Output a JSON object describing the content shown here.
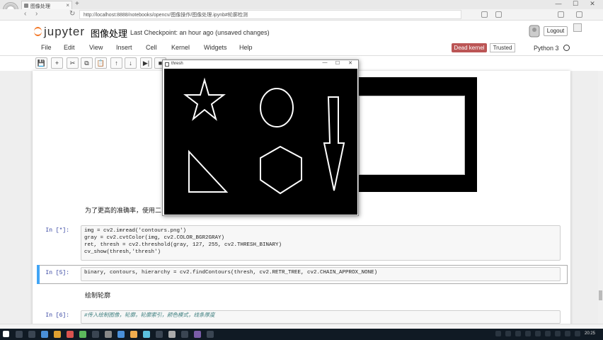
{
  "browser": {
    "tab_title": "图像处理",
    "url": "http://localhost:8888/notebooks/opencv/图像操作/图像处理.ipynb#轮廓检测",
    "new_tab": "+",
    "back": "‹",
    "forward": "›",
    "reload": "↻",
    "window_min": "—",
    "window_max": "☐",
    "window_close": "✕"
  },
  "jupyter": {
    "logo_text": "jupyter",
    "notebook_name": "图像处理",
    "checkpoint": "Last Checkpoint: an hour ago  (unsaved changes)",
    "logout": "Logout",
    "menu": [
      "File",
      "Edit",
      "View",
      "Insert",
      "Cell",
      "Kernel",
      "Widgets",
      "Help"
    ],
    "dead_kernel": "Dead kernel",
    "trusted": "Trusted",
    "kernel_name": "Python 3"
  },
  "toolbar": {
    "buttons": [
      "💾",
      "+",
      "✂",
      "⧉",
      "📋",
      "↑",
      "↓",
      "▶|",
      "■"
    ]
  },
  "notebook": {
    "md1": "为了更高的准确率，使用二",
    "cell1_prompt": "In [*]:",
    "cell1_lines": [
      "img = cv2.imread('contours.png')",
      "gray = cv2.cvtColor(img, cv2.COLOR_BGR2GRAY)",
      "ret, thresh = cv2.threshold(gray, 127, 255, cv2.THRESH_BINARY)",
      "cv_show(thresh,'thresh')"
    ],
    "cell2_prompt": "In [5]:",
    "cell2_line": "binary, contours, hierarchy = cv2.findContours(thresh, cv2.RETR_TREE, cv2.CHAIN_APPROX_NONE)",
    "md2": "绘制轮廓",
    "cell3_prompt": "In [6]:",
    "cell3_line": "#传入绘制图像，轮廓，轮廓索引，颜色模式，线条厚度"
  },
  "thresh_window": {
    "title": "thresh",
    "min": "—",
    "max": "☐",
    "close": "✕"
  },
  "taskbar": {
    "time": "20:25"
  }
}
